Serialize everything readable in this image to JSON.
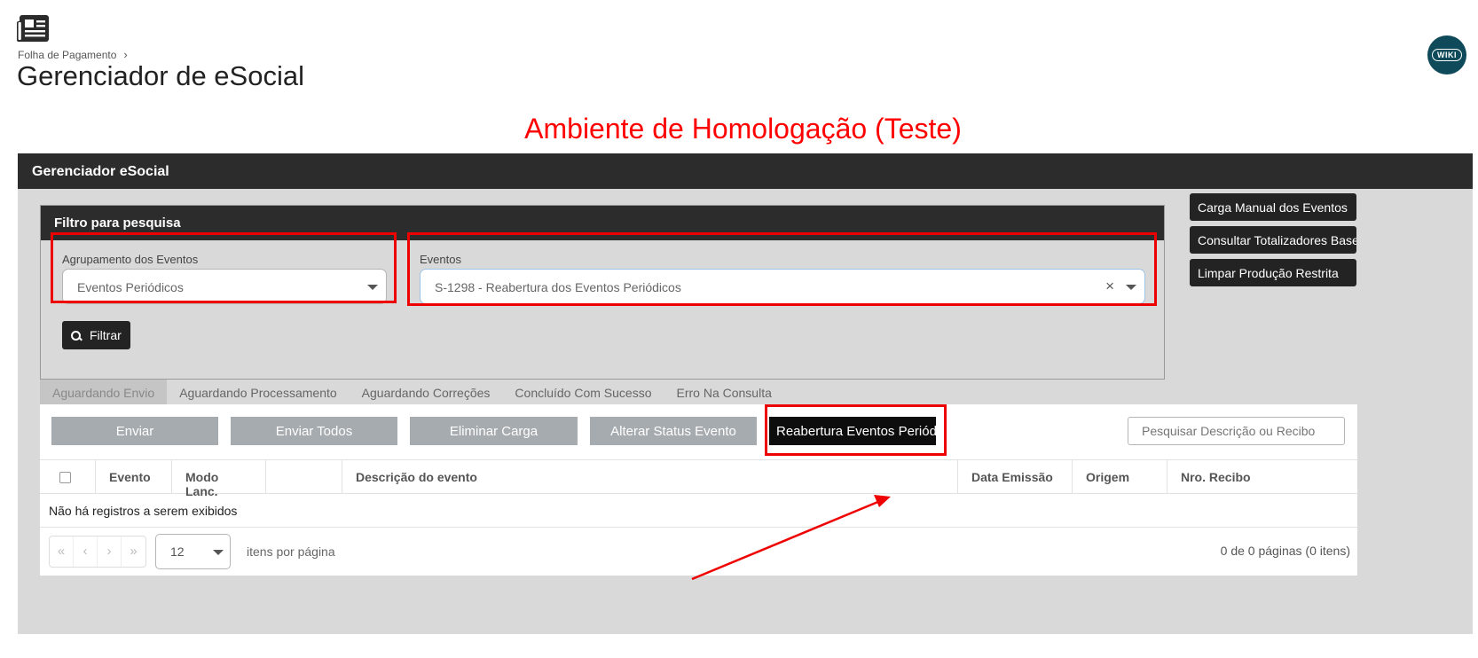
{
  "header": {
    "breadcrumb": "Folha de Pagamento",
    "title": "Gerenciador de eSocial",
    "wiki_label": "WIKI"
  },
  "environment_banner": "Ambiente de Homologação (Teste)",
  "panel": {
    "title": "Gerenciador eSocial",
    "filter": {
      "title": "Filtro para pesquisa",
      "grouping_label": "Agrupamento dos Eventos",
      "grouping_value": "Eventos Periódicos",
      "events_label": "Eventos",
      "events_value": "S-1298 - Reabertura dos Eventos Periódicos",
      "clear_symbol": "×",
      "filter_button": "Filtrar"
    },
    "side_buttons": [
      "Carga Manual dos Eventos",
      "Consultar Totalizadores Base",
      "Limpar Produção Restrita"
    ],
    "tabs": [
      "Aguardando Envio",
      "Aguardando Processamento",
      "Aguardando Correções",
      "Concluído Com Sucesso",
      "Erro Na Consulta"
    ],
    "actions": {
      "enviar": "Enviar",
      "enviar_todos": "Enviar Todos",
      "eliminar_carga": "Eliminar Carga",
      "alterar_status": "Alterar Status Evento",
      "reabertura": "Reabertura Eventos Periódicos"
    },
    "search_placeholder": "Pesquisar Descrição ou Recibo",
    "columns": [
      "Evento",
      "Modo Lanc.",
      "",
      "Descrição do evento",
      "Data Emissão",
      "Origem",
      "Nro. Recibo"
    ],
    "empty_message": "Não há registros a serem exibidos",
    "pager": {
      "nav": [
        "«",
        "‹",
        "›",
        "»"
      ],
      "page_size": "12",
      "per_page_label": "itens por página",
      "info": "0 de 0 páginas (0 itens)"
    }
  },
  "colors": {
    "banner": "#ff0000",
    "header_bar": "#2c2c2c",
    "panel_bg": "#d9d9d9",
    "action_button": "#a6abb0",
    "highlight_frame": "#e00000"
  }
}
